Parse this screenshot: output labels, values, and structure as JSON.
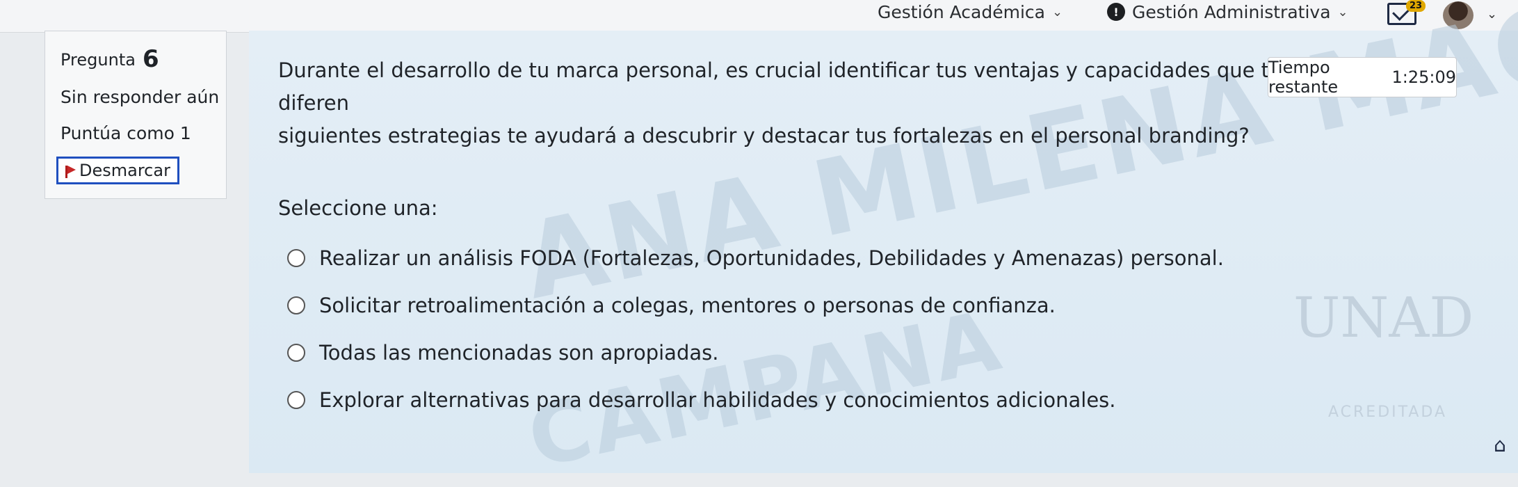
{
  "nav": {
    "academica": "Gestión Académica",
    "administrativa": "Gestión Administrativa",
    "info_icon": "!",
    "mail_badge": "23"
  },
  "question_info": {
    "label": "Pregunta",
    "number": "6",
    "state": "Sin responder aún",
    "grade": "Puntúa como 1",
    "flag_label": "Desmarcar"
  },
  "timer": {
    "label": "Tiempo restante",
    "value": "1:25:09"
  },
  "question": {
    "text": "Durante el desarrollo de tu marca personal, es crucial identificar tus ventajas y capacidades que te diferen",
    "text2": "siguientes estrategias te ayudará a descubrir y destacar tus fortalezas en el personal branding?",
    "select_label": "Seleccione una:",
    "options": [
      "Realizar un análisis FODA (Fortalezas, Oportunidades, Debilidades y Amenazas) personal.",
      "Solicitar retroalimentación a colegas, mentores o personas de confianza.",
      "Todas las mencionadas son apropiadas.",
      "Explorar alternativas para desarrollar habilidades y conocimientos adicionales."
    ]
  },
  "watermark": {
    "line1": "ANA MILENA MACHADO",
    "line2": "CAMPANA",
    "logo": "UNAD",
    "logo_sub": "ACREDITADA"
  },
  "icons": {
    "mail": "mail-icon",
    "avatar": "avatar",
    "flag": "flag-icon",
    "scroll_top": "arrow-up-icon"
  }
}
